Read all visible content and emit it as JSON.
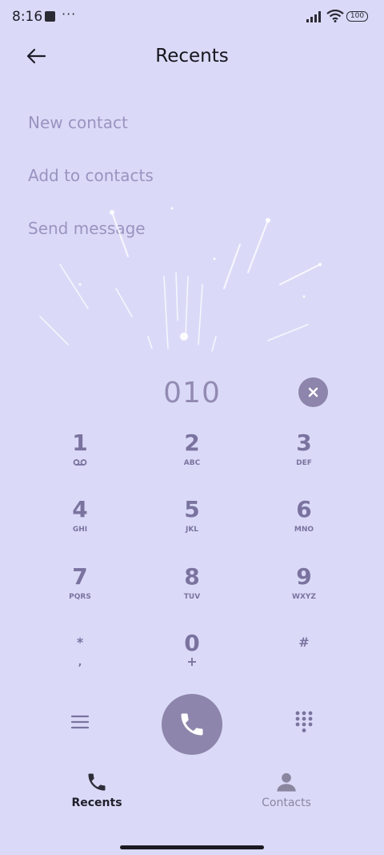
{
  "status_bar": {
    "time": "8:16",
    "more": "···",
    "battery": "100"
  },
  "header": {
    "title": "Recents"
  },
  "menu": {
    "new_contact": "New contact",
    "add_to_contacts": "Add to contacts",
    "send_message": "Send message"
  },
  "dialer": {
    "number": "010"
  },
  "keypad": [
    {
      "digit": "1",
      "letters": ""
    },
    {
      "digit": "2",
      "letters": "ABC"
    },
    {
      "digit": "3",
      "letters": "DEF"
    },
    {
      "digit": "4",
      "letters": "GHI"
    },
    {
      "digit": "5",
      "letters": "JKL"
    },
    {
      "digit": "6",
      "letters": "MNO"
    },
    {
      "digit": "7",
      "letters": "PQRS"
    },
    {
      "digit": "8",
      "letters": "TUV"
    },
    {
      "digit": "9",
      "letters": "WXYZ"
    },
    {
      "digit": "*",
      "letters": ","
    },
    {
      "digit": "0",
      "letters": "+"
    },
    {
      "digit": "#",
      "letters": ""
    }
  ],
  "nav": {
    "recents": "Recents",
    "contacts": "Contacts"
  },
  "colors": {
    "background": "#dadaf8",
    "accent": "#8d85ab",
    "key_text": "#7a739f",
    "menu_text": "#9a93c0"
  }
}
